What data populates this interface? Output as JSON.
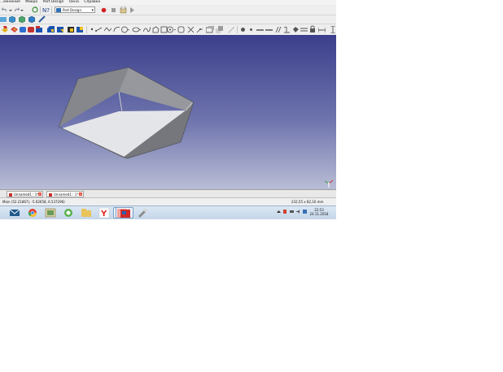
{
  "menubar": {
    "items": [
      "...менения",
      "Макро",
      "Part Design",
      "Окна",
      "Справка"
    ]
  },
  "toolbar": {
    "workbench": "Part Design"
  },
  "tabs": [
    {
      "label": "Unnamed1 : 1*"
    },
    {
      "label": "Unnamed1 : 1*"
    }
  ],
  "status": {
    "preselected": "Main (52.21867), -5.62658, 6.537296)",
    "dimensions": "232,55 x 82,16 mm"
  },
  "taskbar": {
    "clock_time": "22:53",
    "clock_date": "24.11.2018"
  },
  "colors": {
    "viewport_top": "#3b3f8c",
    "viewport_bottom": "#b9bdd5",
    "model_face": "#8d8f94",
    "model_floor": "#e4e5e8"
  }
}
